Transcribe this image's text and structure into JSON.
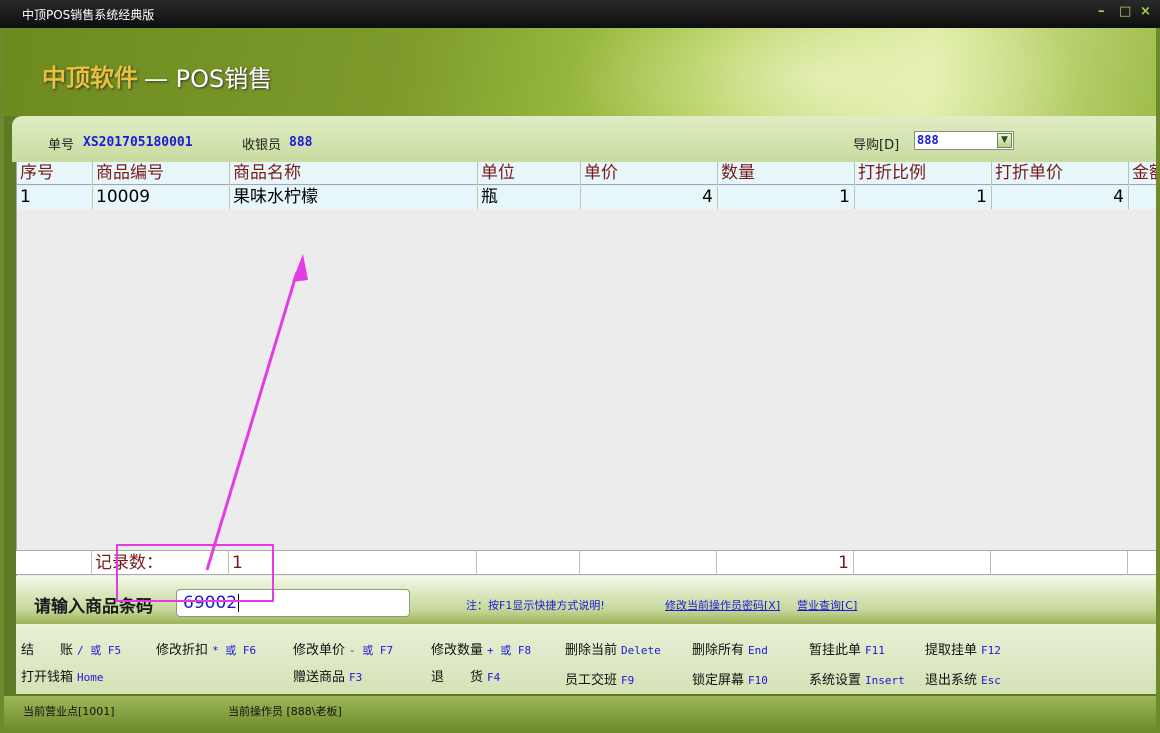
{
  "window": {
    "title": "中顶POS销售系统经典版",
    "controls": [
      "–",
      "□",
      "×"
    ]
  },
  "header": {
    "brand": "中顶软件",
    "subtitle": "— POS销售"
  },
  "order": {
    "order_no_label": "单号",
    "order_no": "XS201705180001",
    "cashier_label": "收银员",
    "cashier": "888",
    "guide_label": "导购[D]",
    "guide_value": "888"
  },
  "table": {
    "columns": [
      "序号",
      "商品编号",
      "商品名称",
      "单位",
      "单价",
      "数量",
      "打折比例",
      "打折单价",
      "金额"
    ],
    "rows": [
      [
        "1",
        "10009",
        "果味水柠檬",
        "瓶",
        "4",
        "1",
        "1",
        "4",
        ""
      ]
    ],
    "footer": {
      "count_label": "记录数：",
      "count": "1",
      "qty_total": "1"
    }
  },
  "input": {
    "label": "请输入商品条码",
    "value": "69002",
    "note": "注：按F1显示快捷方式说明!",
    "link_password": "修改当前操作员密码[X]",
    "link_query": "营业查询[C]"
  },
  "shortcuts": [
    {
      "label": "结　　账",
      "key": "/ 或 F5"
    },
    {
      "label": "修改折扣",
      "key": "* 或 F6"
    },
    {
      "label": "修改单价",
      "key": "- 或 F7"
    },
    {
      "label": "修改数量",
      "key": "+ 或 F8"
    },
    {
      "label": "删除当前",
      "key": "Delete"
    },
    {
      "label": "删除所有",
      "key": "End"
    },
    {
      "label": "暂挂此单",
      "key": "F11"
    },
    {
      "label": "提取挂单",
      "key": "F12"
    },
    {
      "label": "打开钱箱",
      "key": "Home"
    },
    {
      "label": "赠送商品",
      "key": "F3"
    },
    {
      "label": "退　　货",
      "key": "F4"
    },
    {
      "label": "员工交班",
      "key": "F9"
    },
    {
      "label": "锁定屏幕",
      "key": "F10"
    },
    {
      "label": "系统设置",
      "key": "Insert"
    },
    {
      "label": "退出系统",
      "key": "Esc"
    }
  ],
  "status": {
    "point": "当前营业点[1001]",
    "operator": "当前操作员 [888\\老板]"
  },
  "colors": {
    "annotation": "#e43ce4",
    "key_blue": "#1a1adb",
    "header_text": "#7a1a1a"
  }
}
